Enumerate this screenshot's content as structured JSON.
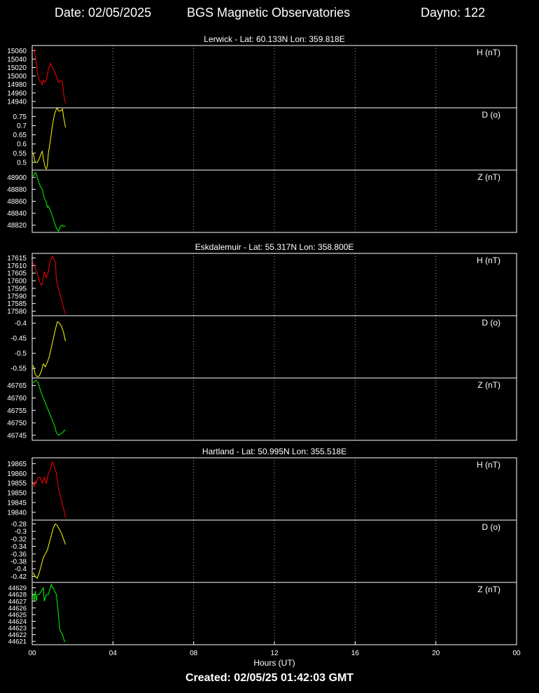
{
  "header": {
    "date": "Date: 02/05/2025",
    "title": "BGS Magnetic Observatories",
    "dayno": "Dayno: 122"
  },
  "footer": {
    "created": "Created: 02/05/25 01:42:03 GMT"
  },
  "colors": {
    "H": "#ff0000",
    "D": "#ffff00",
    "Z": "#00ff00",
    "background": "#000000",
    "axes": "#ffffff",
    "grid": "#aaaaaa"
  },
  "chart_data": {
    "type": "line",
    "xlabel": "Hours (UT)",
    "x_ticks": [
      "00",
      "04",
      "08",
      "12",
      "16",
      "20",
      "00"
    ],
    "xlim": [
      0,
      24
    ],
    "grid": "vertical dotted",
    "observatories": [
      {
        "title": "Lerwick - Lat: 60.133N Lon: 359.818E",
        "panels": [
          {
            "component": "H",
            "label": "H (nT)",
            "color": "#ff0000",
            "ylim": [
              14925,
              15072
            ],
            "ticks": [
              15060,
              15040,
              15020,
              15000,
              14980,
              14960,
              14940
            ],
            "x": [
              0.05,
              0.1,
              0.15,
              0.2,
              0.25,
              0.35,
              0.45,
              0.5,
              0.55,
              0.6,
              0.7,
              0.8,
              0.9,
              1.0,
              1.1,
              1.2,
              1.3,
              1.4,
              1.5,
              1.55,
              1.6,
              1.65
            ],
            "y": [
              15060,
              15062,
              15048,
              15032,
              15010,
              14990,
              14985,
              14980,
              14990,
              14985,
              14990,
              15015,
              15030,
              15020,
              15010,
              15000,
              14985,
              14990,
              14985,
              14960,
              14945,
              14935
            ]
          },
          {
            "component": "D",
            "label": "D (o)",
            "color": "#ffff00",
            "ylim": [
              0.458,
              0.797
            ],
            "ticks": [
              0.75,
              0.7,
              0.65,
              0.6,
              0.55,
              0.5
            ],
            "x": [
              0.05,
              0.15,
              0.25,
              0.35,
              0.45,
              0.5,
              0.55,
              0.65,
              0.7,
              0.75,
              0.8,
              0.9,
              1.0,
              1.1,
              1.2,
              1.25,
              1.3,
              1.4,
              1.5,
              1.55,
              1.6,
              1.65
            ],
            "y": [
              0.55,
              0.5,
              0.5,
              0.52,
              0.55,
              0.56,
              0.52,
              0.47,
              0.465,
              0.48,
              0.55,
              0.62,
              0.7,
              0.76,
              0.79,
              0.795,
              0.78,
              0.78,
              0.79,
              0.75,
              0.72,
              0.69
            ]
          },
          {
            "component": "Z",
            "label": "Z (nT)",
            "color": "#00ff00",
            "ylim": [
              48808,
              48912
            ],
            "ticks": [
              48900,
              48880,
              48860,
              48840,
              48820
            ],
            "x": [
              0.05,
              0.1,
              0.15,
              0.2,
              0.3,
              0.4,
              0.5,
              0.6,
              0.7,
              0.75,
              0.8,
              0.85,
              0.9,
              1.0,
              1.1,
              1.2,
              1.3,
              1.35,
              1.4,
              1.5,
              1.55,
              1.6,
              1.65
            ],
            "y": [
              48902,
              48905,
              48908,
              48906,
              48895,
              48885,
              48880,
              48865,
              48858,
              48850,
              48852,
              48848,
              48845,
              48835,
              48825,
              48815,
              48810,
              48814,
              48818,
              48820,
              48818,
              48818,
              48819
            ]
          }
        ]
      },
      {
        "title": "Eskdalemuir - Lat: 55.317N Lon: 358.800E",
        "panels": [
          {
            "component": "H",
            "label": "H (nT)",
            "color": "#ff0000",
            "ylim": [
              17577,
              17618
            ],
            "ticks": [
              17615,
              17610,
              17605,
              17600,
              17595,
              17590,
              17585,
              17580
            ],
            "x": [
              0.05,
              0.15,
              0.25,
              0.35,
              0.45,
              0.5,
              0.6,
              0.7,
              0.8,
              0.9,
              1.0,
              1.05,
              1.15,
              1.2,
              1.3,
              1.4,
              1.5,
              1.6,
              1.65
            ],
            "y": [
              17612,
              17608,
              17605,
              17600,
              17597,
              17598,
              17606,
              17602,
              17606,
              17614,
              17616,
              17615,
              17612,
              17600,
              17595,
              17590,
              17585,
              17580,
              17578
            ]
          },
          {
            "component": "D",
            "label": "D (o)",
            "color": "#ffff00",
            "ylim": [
              -0.582,
              -0.375
            ],
            "ticks": [
              -0.4,
              -0.45,
              -0.5,
              -0.55
            ],
            "x": [
              0.05,
              0.15,
              0.25,
              0.35,
              0.45,
              0.55,
              0.65,
              0.75,
              0.85,
              0.95,
              1.05,
              1.15,
              1.25,
              1.35,
              1.45,
              1.55,
              1.6,
              1.65
            ],
            "y": [
              -0.54,
              -0.57,
              -0.578,
              -0.575,
              -0.56,
              -0.535,
              -0.545,
              -0.53,
              -0.51,
              -0.48,
              -0.45,
              -0.42,
              -0.395,
              -0.4,
              -0.41,
              -0.43,
              -0.445,
              -0.46
            ]
          },
          {
            "component": "Z",
            "label": "Z (nT)",
            "color": "#00ff00",
            "ylim": [
              46743,
              46768
            ],
            "ticks": [
              46765,
              46760,
              46755,
              46750,
              46745
            ],
            "x": [
              0.05,
              0.15,
              0.2,
              0.3,
              0.45,
              0.6,
              0.75,
              0.9,
              1.0,
              1.1,
              1.2,
              1.3,
              1.4,
              1.5,
              1.6,
              1.65
            ],
            "y": [
              46766,
              46767,
              46767,
              46766,
              46762,
              46759,
              46756,
              46753,
              46751,
              46749,
              46746,
              46745,
              46745.5,
              46746,
              46747,
              46747
            ]
          }
        ]
      },
      {
        "title": "Hartland - Lat: 50.995N Lon: 355.518E",
        "panels": [
          {
            "component": "H",
            "label": "H (nT)",
            "color": "#ff0000",
            "ylim": [
              19836,
              19868
            ],
            "ticks": [
              19865,
              19860,
              19855,
              19850,
              19845,
              19840
            ],
            "x": [
              0.05,
              0.1,
              0.15,
              0.2,
              0.3,
              0.4,
              0.5,
              0.6,
              0.7,
              0.8,
              0.9,
              1.0,
              1.05,
              1.1,
              1.2,
              1.3,
              1.4,
              1.5,
              1.6,
              1.65
            ],
            "y": [
              19855,
              19853,
              19856,
              19855,
              19858,
              19858,
              19855,
              19858,
              19855,
              19860,
              19862,
              19866,
              19865,
              19863,
              19860,
              19852,
              19848,
              19844,
              19840,
              19837
            ]
          },
          {
            "component": "D",
            "label": "D (o)",
            "color": "#ffff00",
            "ylim": [
              -0.436,
              -0.27
            ],
            "ticks": [
              -0.28,
              -0.3,
              -0.32,
              -0.34,
              -0.36,
              -0.38,
              -0.4,
              -0.42
            ],
            "x": [
              0.05,
              0.15,
              0.25,
              0.35,
              0.45,
              0.55,
              0.65,
              0.75,
              0.85,
              0.95,
              1.05,
              1.15,
              1.25,
              1.35,
              1.45,
              1.55,
              1.65
            ],
            "y": [
              -0.41,
              -0.42,
              -0.425,
              -0.41,
              -0.39,
              -0.37,
              -0.36,
              -0.35,
              -0.33,
              -0.31,
              -0.29,
              -0.28,
              -0.285,
              -0.295,
              -0.305,
              -0.32,
              -0.335
            ]
          },
          {
            "component": "Z",
            "label": "Z (nT)",
            "color": "#00ff00",
            "ylim": [
              44620.5,
              44629.8
            ],
            "ticks": [
              44629,
              44628,
              44627,
              44626,
              44625,
              44624,
              44623,
              44622,
              44621
            ],
            "x": [
              0.05,
              0.1,
              0.15,
              0.2,
              0.25,
              0.35,
              0.45,
              0.55,
              0.6,
              0.7,
              0.8,
              0.9,
              0.95,
              1.0,
              1.05,
              1.1,
              1.2,
              1.3,
              1.35,
              1.4,
              1.5,
              1.55,
              1.6,
              1.65
            ],
            "y": [
              44628,
              44627,
              44628.5,
              44627,
              44628,
              44628,
              44628.5,
              44629,
              44627,
              44628,
              44628,
              44629,
              44629.5,
              44629,
              44629,
              44628.5,
              44628,
              44625,
              44623,
              44622.5,
              44622,
              44621.5,
              44621,
              44621
            ]
          }
        ]
      }
    ]
  }
}
